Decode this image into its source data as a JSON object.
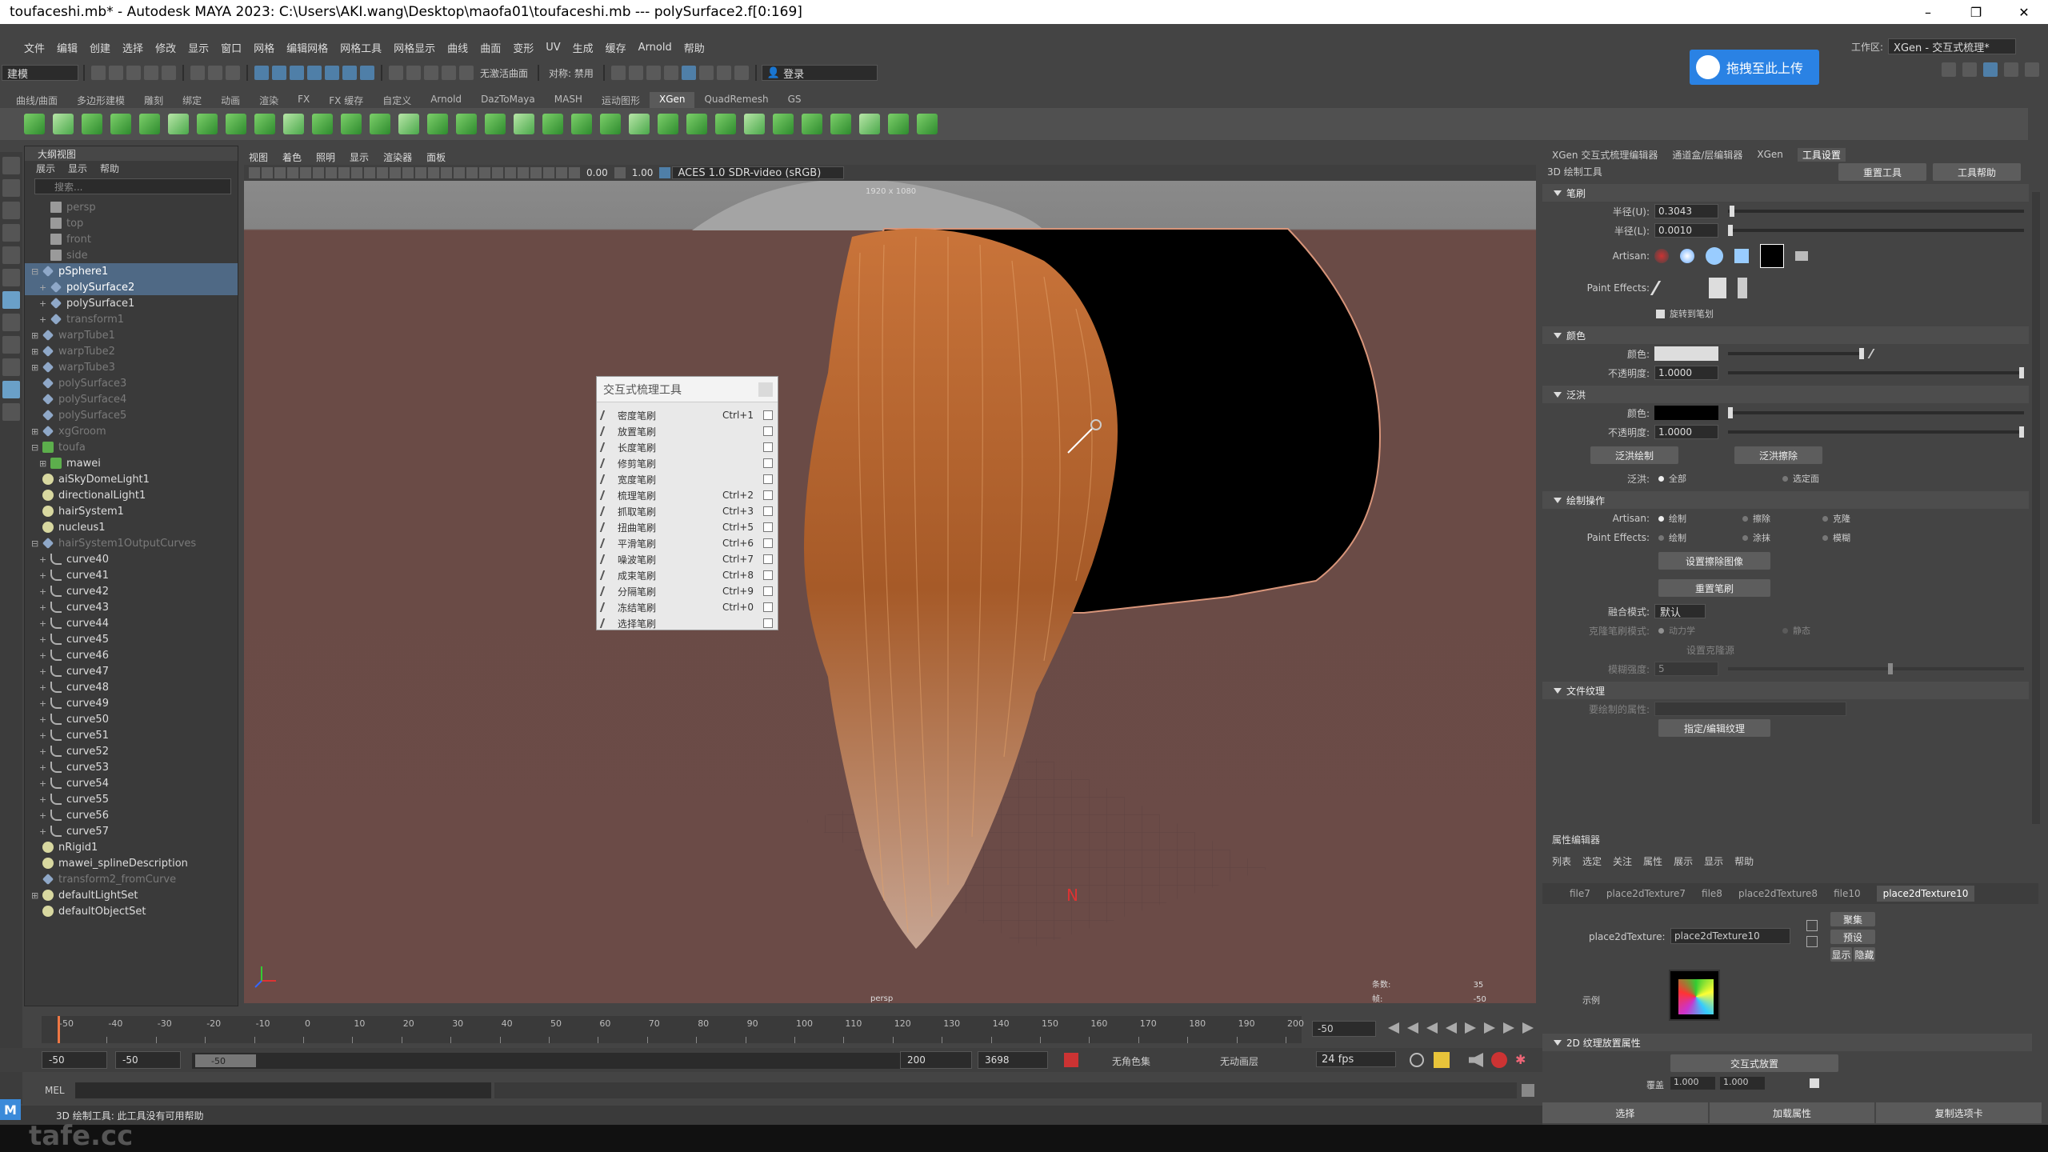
{
  "window": {
    "title": "toufaceshi.mb* - Autodesk MAYA 2023: C:\\Users\\AKI.wang\\Desktop\\maofa01\\toufaceshi.mb   ---   polySurface2.f[0:169]",
    "controls": [
      "–",
      "❐",
      "✕"
    ]
  },
  "menubar": [
    "文件",
    "编辑",
    "创建",
    "选择",
    "修改",
    "显示",
    "窗口",
    "网格",
    "编辑网格",
    "网格工具",
    "网格显示",
    "曲线",
    "曲面",
    "变形",
    "UV",
    "生成",
    "缓存",
    "Arnold",
    "帮助"
  ],
  "statusbar": {
    "mode": "建模",
    "no_active_surface": "无激活曲面",
    "symmetry": "对称: 禁用",
    "login": "登录"
  },
  "workspace": {
    "label": "工作区:",
    "value": "XGen - 交互式梳理*"
  },
  "upload_button": "拖拽至此上传",
  "shelf_tabs": [
    "曲线/曲面",
    "多边形建模",
    "雕刻",
    "绑定",
    "动画",
    "渲染",
    "FX",
    "FX 缓存",
    "自定义",
    "Arnold",
    "DazToMaya",
    "MASH",
    "运动图形",
    "XGen",
    "QuadRemesh",
    "GS"
  ],
  "shelf_active": "XGen",
  "outliner": {
    "title": "大纲视图",
    "menu": [
      "展示",
      "显示",
      "帮助"
    ],
    "search_placeholder": "搜索...",
    "items": [
      {
        "label": "persp",
        "indent": 1,
        "icon": "cam",
        "dim": true
      },
      {
        "label": "top",
        "indent": 1,
        "icon": "cam",
        "dim": true
      },
      {
        "label": "front",
        "indent": 1,
        "icon": "cam",
        "dim": true
      },
      {
        "label": "side",
        "indent": 1,
        "icon": "cam",
        "dim": true
      },
      {
        "label": "pSphere1",
        "indent": 0,
        "icon": "mesh",
        "plus": "⊟",
        "sel": true
      },
      {
        "label": "polySurface2",
        "indent": 1,
        "icon": "mesh",
        "plus": "+",
        "sel": true
      },
      {
        "label": "polySurface1",
        "indent": 1,
        "icon": "mesh",
        "plus": "+"
      },
      {
        "label": "transform1",
        "indent": 1,
        "icon": "mesh",
        "plus": "+",
        "dim": true
      },
      {
        "label": "warpTube1",
        "indent": 0,
        "icon": "mesh",
        "plus": "⊞",
        "dim": true
      },
      {
        "label": "warpTube2",
        "indent": 0,
        "icon": "mesh",
        "plus": "⊞",
        "dim": true
      },
      {
        "label": "warpTube3",
        "indent": 0,
        "icon": "mesh",
        "plus": "⊞",
        "dim": true
      },
      {
        "label": "polySurface3",
        "indent": 0,
        "icon": "mesh",
        "dim": true
      },
      {
        "label": "polySurface4",
        "indent": 0,
        "icon": "mesh",
        "dim": true
      },
      {
        "label": "polySurface5",
        "indent": 0,
        "icon": "mesh",
        "dim": true
      },
      {
        "label": "xgGroom",
        "indent": 0,
        "icon": "mesh",
        "plus": "⊞",
        "dim": true
      },
      {
        "label": "toufa",
        "indent": 0,
        "icon": "green",
        "plus": "⊟",
        "dim": true
      },
      {
        "label": "mawei",
        "indent": 1,
        "icon": "green",
        "plus": "⊞"
      },
      {
        "label": "aiSkyDomeLight1",
        "indent": 0,
        "icon": "light"
      },
      {
        "label": "directionalLight1",
        "indent": 0,
        "icon": "light"
      },
      {
        "label": "hairSystem1",
        "indent": 0,
        "icon": "light"
      },
      {
        "label": "nucleus1",
        "indent": 0,
        "icon": "light"
      },
      {
        "label": "hairSystem1OutputCurves",
        "indent": 0,
        "icon": "mesh",
        "plus": "⊟",
        "dim": true
      },
      {
        "label": "curve40",
        "indent": 1,
        "icon": "curve",
        "plus": "+"
      },
      {
        "label": "curve41",
        "indent": 1,
        "icon": "curve",
        "plus": "+"
      },
      {
        "label": "curve42",
        "indent": 1,
        "icon": "curve",
        "plus": "+"
      },
      {
        "label": "curve43",
        "indent": 1,
        "icon": "curve",
        "plus": "+"
      },
      {
        "label": "curve44",
        "indent": 1,
        "icon": "curve",
        "plus": "+"
      },
      {
        "label": "curve45",
        "indent": 1,
        "icon": "curve",
        "plus": "+"
      },
      {
        "label": "curve46",
        "indent": 1,
        "icon": "curve",
        "plus": "+"
      },
      {
        "label": "curve47",
        "indent": 1,
        "icon": "curve",
        "plus": "+"
      },
      {
        "label": "curve48",
        "indent": 1,
        "icon": "curve",
        "plus": "+"
      },
      {
        "label": "curve49",
        "indent": 1,
        "icon": "curve",
        "plus": "+"
      },
      {
        "label": "curve50",
        "indent": 1,
        "icon": "curve",
        "plus": "+"
      },
      {
        "label": "curve51",
        "indent": 1,
        "icon": "curve",
        "plus": "+"
      },
      {
        "label": "curve52",
        "indent": 1,
        "icon": "curve",
        "plus": "+"
      },
      {
        "label": "curve53",
        "indent": 1,
        "icon": "curve",
        "plus": "+"
      },
      {
        "label": "curve54",
        "indent": 1,
        "icon": "curve",
        "plus": "+"
      },
      {
        "label": "curve55",
        "indent": 1,
        "icon": "curve",
        "plus": "+"
      },
      {
        "label": "curve56",
        "indent": 1,
        "icon": "curve",
        "plus": "+"
      },
      {
        "label": "curve57",
        "indent": 1,
        "icon": "curve",
        "plus": "+"
      },
      {
        "label": "nRigid1",
        "indent": 0,
        "icon": "light"
      },
      {
        "label": "mawei_splineDescription",
        "indent": 0,
        "icon": "light"
      },
      {
        "label": "transform2_fromCurve",
        "indent": 0,
        "icon": "mesh",
        "dim": true
      },
      {
        "label": "defaultLightSet",
        "indent": 0,
        "icon": "light",
        "plus": "⊞"
      },
      {
        "label": "defaultObjectSet",
        "indent": 0,
        "icon": "light"
      }
    ]
  },
  "viewport": {
    "menu": [
      "视图",
      "着色",
      "照明",
      "显示",
      "渲染器",
      "面板"
    ],
    "exposure": "0.00",
    "gamma": "1.00",
    "color_space": "ACES 1.0 SDR-video (sRGB)",
    "resolution": "1920 x 1080",
    "camera": "persp",
    "stat_label1": "条数:",
    "stat_label2": "帧:",
    "stat_val1": "35",
    "stat_val2": "-50"
  },
  "popup": {
    "title": "交互式梳理工具",
    "items": [
      {
        "label": "密度笔刷",
        "shortcut": "Ctrl+1"
      },
      {
        "label": "放置笔刷",
        "shortcut": ""
      },
      {
        "label": "长度笔刷",
        "shortcut": ""
      },
      {
        "label": "修剪笔刷",
        "shortcut": ""
      },
      {
        "label": "宽度笔刷",
        "shortcut": ""
      },
      {
        "label": "梳理笔刷",
        "shortcut": "Ctrl+2"
      },
      {
        "label": "抓取笔刷",
        "shortcut": "Ctrl+3"
      },
      {
        "label": "扭曲笔刷",
        "shortcut": "Ctrl+5"
      },
      {
        "label": "平滑笔刷",
        "shortcut": "Ctrl+6"
      },
      {
        "label": "噪波笔刷",
        "shortcut": "Ctrl+7"
      },
      {
        "label": "成束笔刷",
        "shortcut": "Ctrl+8"
      },
      {
        "label": "分隔笔刷",
        "shortcut": "Ctrl+9"
      },
      {
        "label": "冻结笔刷",
        "shortcut": "Ctrl+0"
      },
      {
        "label": "选择笔刷",
        "shortcut": ""
      }
    ]
  },
  "right_tabs": [
    "XGen 交互式梳理编辑器",
    "通道盒/层编辑器",
    "XGen",
    "工具设置"
  ],
  "right_tab_active": "工具设置",
  "tool_settings": {
    "tool_name": "3D 绘制工具",
    "reset_tool": "重置工具",
    "tool_help": "工具帮助",
    "brush_header": "笔刷",
    "radius_u_label": "半径(U):",
    "radius_u": "0.3043",
    "radius_l_label": "半径(L):",
    "radius_l": "0.0010",
    "artisan_label": "Artisan:",
    "paint_effects_label": "Paint Effects:",
    "rotate_to_stroke": "旋转到笔划",
    "color_header": "颜色",
    "color_label": "颜色:",
    "opacity_label": "不透明度:",
    "color_opacity": "1.0000",
    "flood_header": "泛洪",
    "flood_color_label": "颜色:",
    "flood_opacity_label": "不透明度:",
    "flood_opacity": "1.0000",
    "flood_paint": "泛洪绘制",
    "flood_erase": "泛洪擦除",
    "flood_label": "泛洪:",
    "flood_all": "全部",
    "flood_selected": "选定面",
    "paint_ops_header": "绘制操作",
    "ops_artisan_label": "Artisan:",
    "ops_pe_label": "Paint Effects:",
    "op_paint": "绘制",
    "op_erase": "擦除",
    "op_clone": "克隆",
    "op_paint2": "绘制",
    "op_smear": "涂抹",
    "op_blur": "模糊",
    "set_erase_image": "设置擦除图像",
    "reset_brush": "重置笔刷",
    "blend_mode_label": "融合模式:",
    "blend_mode": "默认",
    "clone_mode_label": "克隆笔刷模式:",
    "clone_dynamic": "动力学",
    "clone_static": "静态",
    "set_clone_source": "设置克隆源",
    "strength_label": "模糊强度:",
    "strength": "5",
    "file_tex_header": "文件纹理",
    "attr_to_paint_label": "要绘制的属性:",
    "assign_edit_tex": "指定/编辑纹理"
  },
  "attribute_editor": {
    "title": "属性编辑器",
    "menu": [
      "列表",
      "选定",
      "关注",
      "属性",
      "展示",
      "显示",
      "帮助"
    ],
    "tabs": [
      "file7",
      "place2dTexture7",
      "file8",
      "place2dTexture8",
      "file10",
      "place2dTexture10"
    ],
    "tab_active": "place2dTexture10",
    "node_label": "place2dTexture:",
    "node_value": "place2dTexture10",
    "focus_btn": "聚集",
    "preset_btn": "预设",
    "show_btn": "显示",
    "hide_btn": "隐藏",
    "sample_label": "示例",
    "section_2d": "2D 纹理放置属性",
    "interactive_place": "交互式放置",
    "coverage_label": "覆盖",
    "coverage_u": "1.000",
    "coverage_v": "1.000",
    "bottom_buttons": [
      "选择",
      "加载属性",
      "复制选项卡"
    ]
  },
  "timeline": {
    "ticks": [
      "-50",
      "-40",
      "-30",
      "-20",
      "-10",
      "0",
      "10",
      "20",
      "30",
      "40",
      "50",
      "60",
      "70",
      "80",
      "90",
      "100",
      "110",
      "120",
      "130",
      "140",
      "150",
      "160",
      "170",
      "180",
      "190",
      "200"
    ],
    "current": "-50"
  },
  "range": {
    "start": "-50",
    "anim_start": "-50",
    "slider_label": "-50",
    "end": "200",
    "anim_end": "3698",
    "no_char_set": "无角色集",
    "no_anim_layer": "无动画层",
    "fps": "24 fps"
  },
  "mel_label": "MEL",
  "help_line": "3D 绘制工具: 此工具没有可用帮助",
  "watermark": "tafe.cc",
  "colors": {
    "bg": "#444444",
    "hair": "#b5652e",
    "sphere": "#000000",
    "upload": "#2a82e4",
    "selected": "#4f6985"
  }
}
